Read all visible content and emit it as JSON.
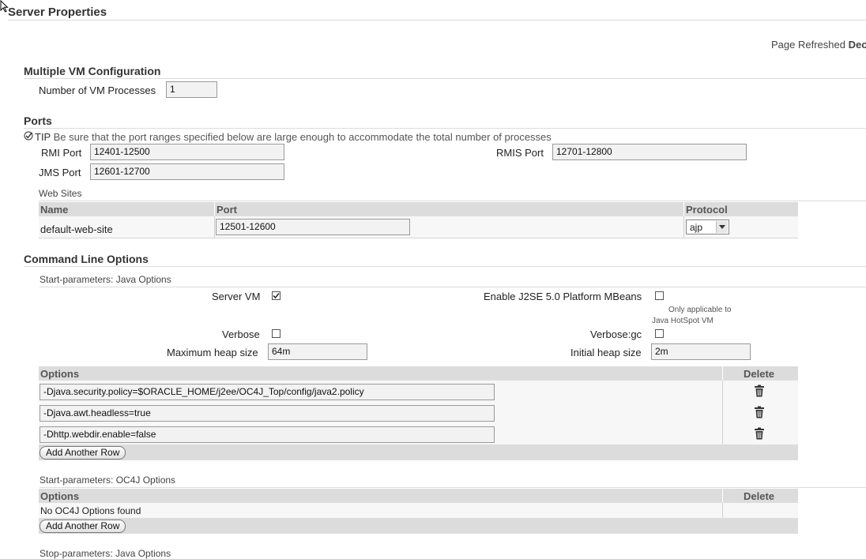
{
  "page": {
    "title": "Server Properties",
    "refreshed_label": "Page Refreshed",
    "refreshed_value": "Dec"
  },
  "vm_config": {
    "heading": "Multiple VM Configuration",
    "processes_label": "Number of VM Processes",
    "processes_value": "1"
  },
  "ports": {
    "heading": "Ports",
    "tip_prefix": "TIP",
    "tip_text": "Be sure that the port ranges specified below are large enough to accommodate the total number of processes",
    "rmi_label": "RMI Port",
    "rmi_value": "12401-12500",
    "rmis_label": "RMIS Port",
    "rmis_value": "12701-12800",
    "jms_label": "JMS Port",
    "jms_value": "12601-12700",
    "web_sites": {
      "heading": "Web Sites",
      "columns": [
        "Name",
        "Port",
        "Protocol"
      ],
      "rows": [
        {
          "name": "default-web-site",
          "port": "12501-12600",
          "protocol": "ajp"
        }
      ]
    }
  },
  "command_line": {
    "heading": "Command Line Options",
    "java_options": {
      "heading": "Start-parameters: Java Options",
      "server_vm_label": "Server VM",
      "server_vm_checked": true,
      "mbeans_label": "Enable J2SE 5.0 Platform MBeans",
      "mbeans_checked": false,
      "mbeans_note_line1": "Only applicable to",
      "mbeans_note_line2": "Java HotSpot VM",
      "verbose_label": "Verbose",
      "verbose_checked": false,
      "verbose_gc_label": "Verbose:gc",
      "verbose_gc_checked": false,
      "max_heap_label": "Maximum heap size",
      "max_heap_value": "64m",
      "init_heap_label": "Initial heap size",
      "init_heap_value": "2m",
      "columns": [
        "Options",
        "Delete"
      ],
      "rows": [
        "-Djava.security.policy=$ORACLE_HOME/j2ee/OC4J_Top/config/java2.policy",
        "-Djava.awt.headless=true",
        "-Dhttp.webdir.enable=false"
      ],
      "add_row_label": "Add Another Row"
    },
    "oc4j_options": {
      "heading": "Start-parameters: OC4J Options",
      "columns": [
        "Options",
        "Delete"
      ],
      "empty_text": "No OC4J Options found",
      "add_row_label": "Add Another Row"
    },
    "stop_java_options": {
      "heading": "Stop-parameters: Java Options"
    }
  },
  "colors": {
    "table_header": "#dcdcdc",
    "row_bg": "#f7f7f7",
    "input_bg": "#f2f2f2"
  }
}
